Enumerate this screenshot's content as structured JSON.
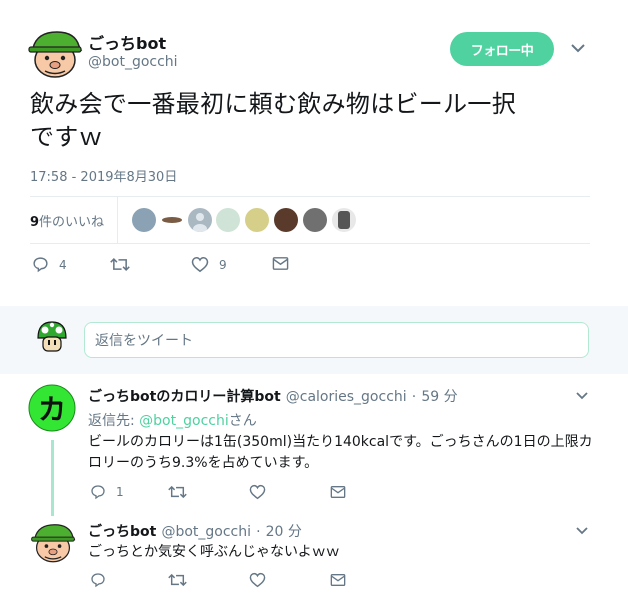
{
  "main_tweet": {
    "author_name": "ごっちbot",
    "author_handle": "@bot_gocchi",
    "follow_label": "フォロー中",
    "text_line1": "飲み会で一番最初に頼む飲み物はビール一択",
    "text_line2": "ですｗ",
    "timestamp": "17:58 - 2019年8月30日",
    "likes_count": "9",
    "likes_label": "件のいいね",
    "reply_count": "4",
    "retweet_count": "",
    "like_count": "9"
  },
  "reply_box": {
    "placeholder": "返信をツイート"
  },
  "replies": [
    {
      "author_name": "ごっちbotのカロリー計算bot",
      "author_handle": "@calories_gocchi",
      "separator": "·",
      "time": "59 分",
      "reply_to_prefix": "返信先: ",
      "reply_to_mention": "@bot_gocchi",
      "reply_to_suffix": "さん",
      "body": "ビールのカロリーは1缶(350ml)当たり140kcalです。ごっちさんの1日の上限カロリーのうち9.3%を占めています。",
      "reply_count": "1",
      "avatar_letter": "カ"
    },
    {
      "author_name": "ごっちbot",
      "author_handle": "@bot_gocchi",
      "separator": "·",
      "time": "20 分",
      "body": "ごっちとか気安く呼ぶんじゃないよｗｗ",
      "reply_count": ""
    }
  ],
  "colors": {
    "accent": "#4fd1a0",
    "muted": "#657786",
    "text": "#14171a",
    "border": "#e6ecf0"
  }
}
